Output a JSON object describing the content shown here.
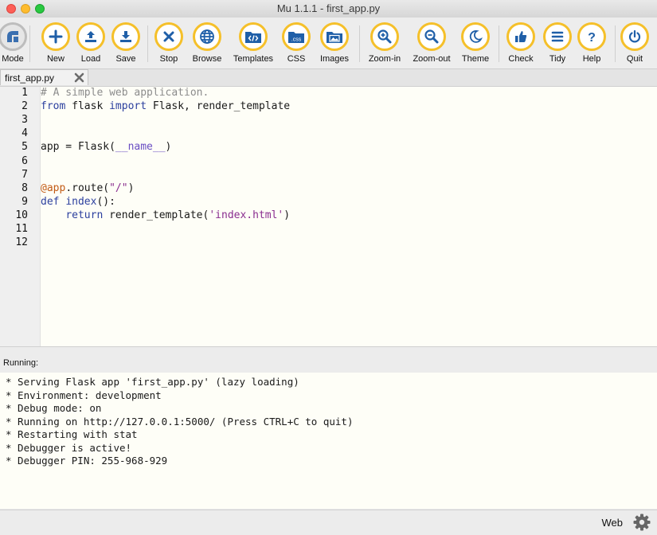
{
  "window": {
    "title": "Mu 1.1.1 - first_app.py"
  },
  "toolbar": {
    "accent": "#f5c02a",
    "buttons": [
      {
        "label": "Mode",
        "icon": "mode-icon"
      },
      {
        "label": "New",
        "icon": "plus-icon"
      },
      {
        "label": "Load",
        "icon": "upload-icon"
      },
      {
        "label": "Save",
        "icon": "download-icon"
      },
      {
        "label": "Stop",
        "icon": "close-icon"
      },
      {
        "label": "Browse",
        "icon": "globe-icon"
      },
      {
        "label": "Templates",
        "icon": "code-folder-icon"
      },
      {
        "label": "CSS",
        "icon": "css-folder-icon"
      },
      {
        "label": "Images",
        "icon": "images-folder-icon"
      },
      {
        "label": "Zoom-in",
        "icon": "zoom-in-icon"
      },
      {
        "label": "Zoom-out",
        "icon": "zoom-out-icon"
      },
      {
        "label": "Theme",
        "icon": "moon-icon"
      },
      {
        "label": "Check",
        "icon": "thumbs-up-icon"
      },
      {
        "label": "Tidy",
        "icon": "tidy-icon"
      },
      {
        "label": "Help",
        "icon": "help-icon"
      },
      {
        "label": "Quit",
        "icon": "power-icon"
      }
    ]
  },
  "tabs": [
    {
      "label": "first_app.py",
      "close_icon": "close-icon"
    }
  ],
  "editor": {
    "line_numbers": [
      "1",
      "2",
      "3",
      "4",
      "5",
      "6",
      "7",
      "8",
      "9",
      "10",
      "11",
      "12"
    ],
    "lines": [
      [
        {
          "t": "cmt",
          "s": "# A simple web application."
        }
      ],
      [
        {
          "t": "kw",
          "s": "from"
        },
        {
          "t": "p",
          "s": " flask "
        },
        {
          "t": "kw",
          "s": "import"
        },
        {
          "t": "p",
          "s": " Flask, render_template"
        }
      ],
      [],
      [],
      [
        {
          "t": "p",
          "s": "app = Flask("
        },
        {
          "t": "dun",
          "s": "__name__"
        },
        {
          "t": "p",
          "s": ")"
        }
      ],
      [],
      [],
      [
        {
          "t": "deco",
          "s": "@app"
        },
        {
          "t": "p",
          "s": ".route("
        },
        {
          "t": "str",
          "s": "\"/\""
        },
        {
          "t": "p",
          "s": ")"
        }
      ],
      [
        {
          "t": "kw",
          "s": "def"
        },
        {
          "t": "p",
          "s": " "
        },
        {
          "t": "kw",
          "s": "index"
        },
        {
          "t": "p",
          "s": "():"
        }
      ],
      [
        {
          "t": "p",
          "s": "    "
        },
        {
          "t": "kw",
          "s": "return"
        },
        {
          "t": "p",
          "s": " render_template("
        },
        {
          "t": "str",
          "s": "'index.html'"
        },
        {
          "t": "p",
          "s": ")"
        }
      ],
      [],
      []
    ]
  },
  "runner": {
    "header": "Running:",
    "output": [
      "* Serving Flask app 'first_app.py' (lazy loading)",
      "* Environment: development",
      "* Debug mode: on",
      "* Running on http://127.0.0.1:5000/ (Press CTRL+C to quit)",
      "* Restarting with stat",
      "* Debugger is active!",
      "* Debugger PIN: 255-968-929"
    ]
  },
  "status": {
    "mode": "Web",
    "settings_icon": "gear-icon"
  }
}
